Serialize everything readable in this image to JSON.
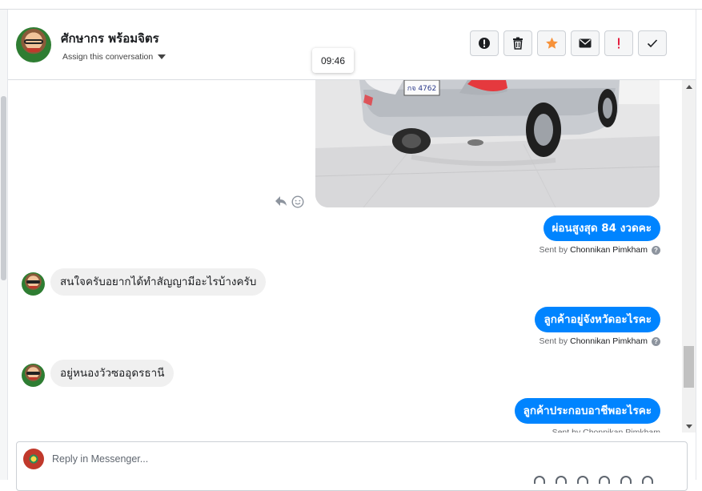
{
  "header": {
    "contact_name": "ศักษากร พร้อมจิตร",
    "assign_label": "Assign this conversation",
    "actions": [
      "mark-spam",
      "delete",
      "star",
      "mark-unread",
      "follow-up",
      "mark-done"
    ]
  },
  "tooltip": {
    "time": "09:46"
  },
  "messages": [
    {
      "dir": "out",
      "text": "ผ่อนสูงสุด 84 งวดคะ",
      "sent_by_prefix": "Sent by",
      "sent_by_name": "Chonnikan Pimkham"
    },
    {
      "dir": "in",
      "text": "สนใจครับอยากได้ทำสัญญามีอะไรบ้างครับ"
    },
    {
      "dir": "out",
      "text": "ลูกค้าอยู่จังหวัดอะไรคะ",
      "sent_by_prefix": "Sent by",
      "sent_by_name": "Chonnikan Pimkham"
    },
    {
      "dir": "in",
      "text": "อยู่หนองวัวซออุดรธานี"
    },
    {
      "dir": "out",
      "text": "ลูกค้าประกอบอาชีพอะไรคะ"
    }
  ],
  "image_message": {
    "plate_text": "กจ 4762"
  },
  "composer": {
    "placeholder": "Reply in Messenger..."
  },
  "colors": {
    "outgoing_bubble": "#0084ff",
    "incoming_bubble": "#f0f0f0",
    "star": "#f7923a",
    "follow_up": "#e41e3f"
  }
}
